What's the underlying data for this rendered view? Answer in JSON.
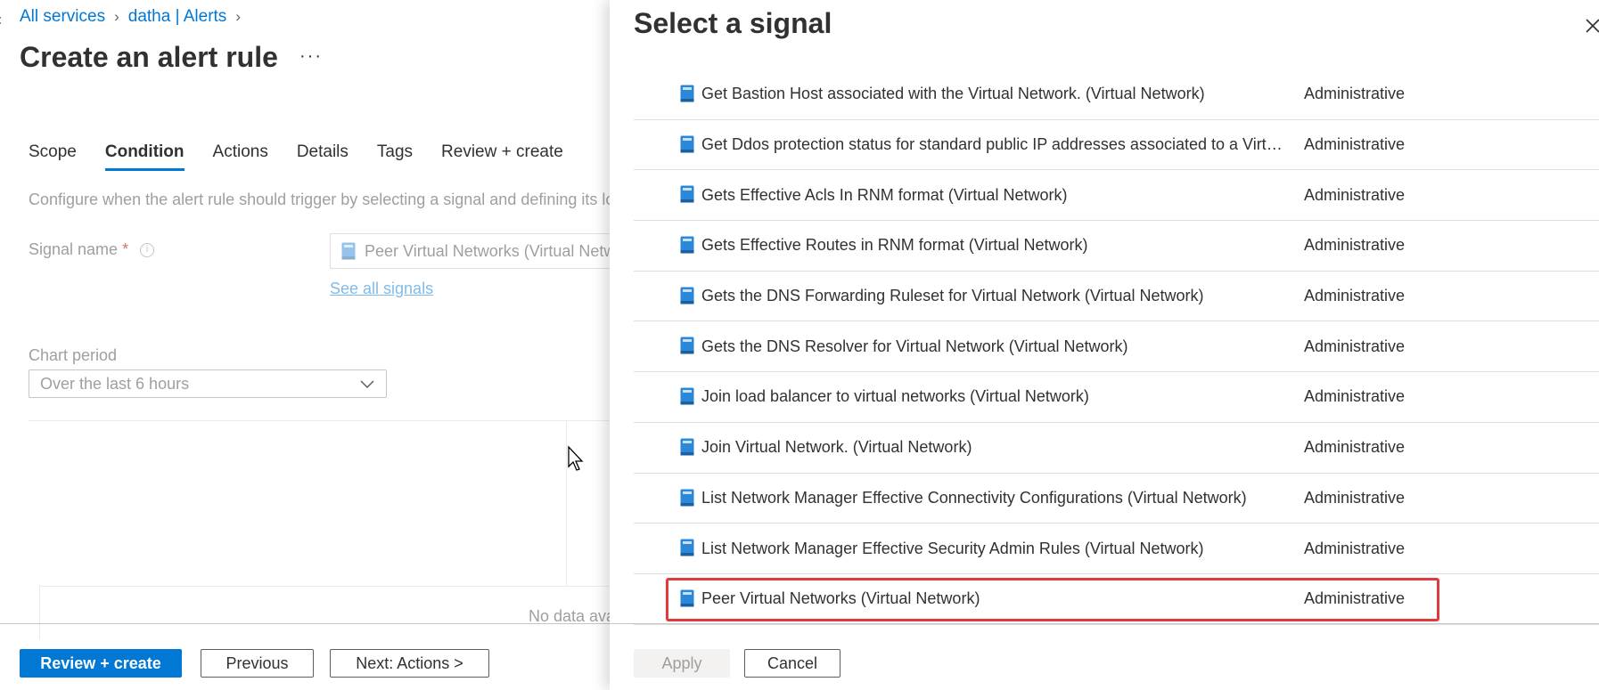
{
  "breadcrumb": {
    "items": [
      "All services",
      "datha | Alerts"
    ]
  },
  "page": {
    "title": "Create an alert rule",
    "more": "···"
  },
  "tabs": [
    "Scope",
    "Condition",
    "Actions",
    "Details",
    "Tags",
    "Review + create"
  ],
  "active_tab": "Condition",
  "condition": {
    "description": "Configure when the alert rule should trigger by selecting a signal and defining its log",
    "signal_label": "Signal name",
    "required_mark": "*",
    "info_glyph": "i",
    "signal_value": "Peer Virtual Networks (Virtual Network)",
    "see_all": "See all signals",
    "chart_period_label": "Chart period",
    "chart_period_value": "Over the last 6 hours",
    "no_data": "No data ava"
  },
  "footer": {
    "review_create": "Review + create",
    "previous": "Previous",
    "next": "Next: Actions >"
  },
  "panel": {
    "title": "Select a signal",
    "apply": "Apply",
    "cancel": "Cancel",
    "signals": [
      {
        "name": "Get Bastion Host associated with the Virtual Network. (Virtual Network)",
        "type": "Administrative"
      },
      {
        "name": "Get Ddos protection status for standard public IP addresses associated to a Virtual ...",
        "type": "Administrative"
      },
      {
        "name": "Gets Effective Acls In RNM format (Virtual Network)",
        "type": "Administrative"
      },
      {
        "name": "Gets Effective Routes in RNM format (Virtual Network)",
        "type": "Administrative"
      },
      {
        "name": "Gets the DNS Forwarding Ruleset for Virtual Network (Virtual Network)",
        "type": "Administrative"
      },
      {
        "name": "Gets the DNS Resolver for Virtual Network (Virtual Network)",
        "type": "Administrative"
      },
      {
        "name": "Join load balancer to virtual networks (Virtual Network)",
        "type": "Administrative"
      },
      {
        "name": "Join Virtual Network. (Virtual Network)",
        "type": "Administrative"
      },
      {
        "name": "List Network Manager Effective Connectivity Configurations (Virtual Network)",
        "type": "Administrative"
      },
      {
        "name": "List Network Manager Effective Security Admin Rules (Virtual Network)",
        "type": "Administrative"
      },
      {
        "name": "Peer Virtual Networks (Virtual Network)",
        "type": "Administrative"
      }
    ],
    "selected_index": 10
  },
  "colors": {
    "accent": "#0078d4",
    "selection_outline": "#e03a3e",
    "log_icon": "#2b88d8"
  },
  "icons": {
    "signal_icon": "activity-log-icon",
    "close": "close-icon",
    "dropdown": "chevron-down-icon",
    "breadcrumb_separator": "chevron-right-icon"
  }
}
